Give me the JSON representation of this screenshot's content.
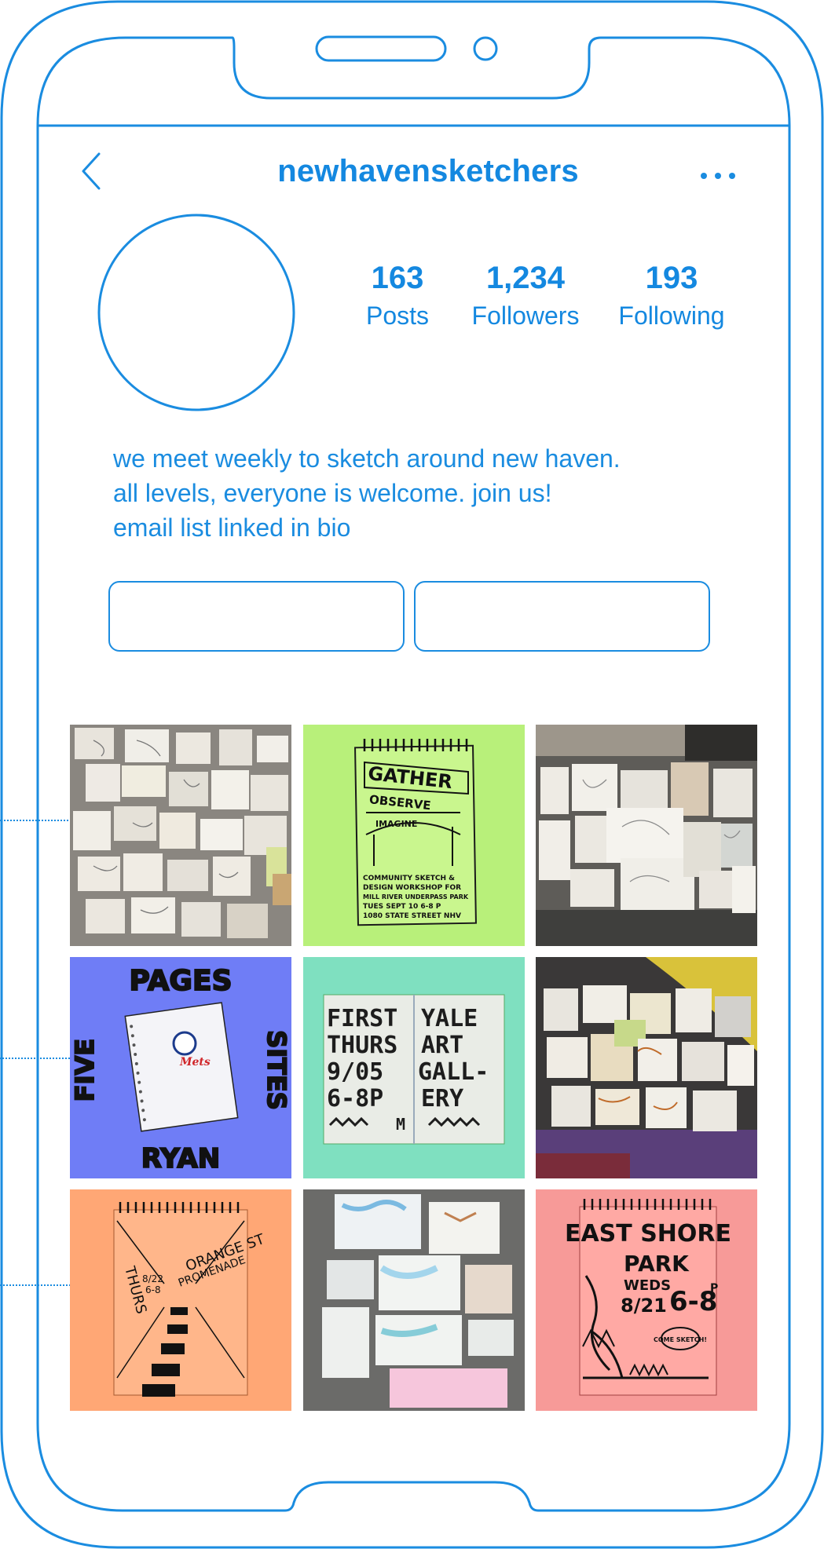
{
  "header": {
    "username": "newhavensketchers",
    "back_icon": "chevron-left-icon",
    "more_icon": "more-horizontal-icon"
  },
  "profile": {
    "avatar": "avatar-placeholder",
    "stats": [
      {
        "value": "163",
        "label": "Posts"
      },
      {
        "value": "1,234",
        "label": "Followers"
      },
      {
        "value": "193",
        "label": "Following"
      }
    ],
    "bio": [
      "we meet weekly to sketch around new haven.",
      "all levels, everyone is welcome. join us!",
      "email list linked in bio"
    ]
  },
  "colors": {
    "outline": "#1a8ce0",
    "tile_green": "#b8f07a",
    "tile_blue": "#6f7df6",
    "tile_teal": "#7fe0c0",
    "tile_orange": "#ffa775",
    "tile_pink": "#f79a98"
  },
  "posts": [
    {
      "kind": "photo-sketchbooks-on-pavement"
    },
    {
      "kind": "poster",
      "text": [
        "GATHER",
        "OBSERVE",
        "IMAGINE",
        "COMMUNITY SKETCH &",
        "DESIGN WORKSHOP FOR",
        "MILL RIVER UNDERPASS PARK",
        "TUES SEPT 10 6-8 P",
        "1080 STATE STREET NHV"
      ]
    },
    {
      "kind": "photo-sketchbooks-on-sidewalk"
    },
    {
      "kind": "poster",
      "text": [
        "PAGES",
        "FIVE",
        "SITES",
        "RYAN",
        "Mets"
      ]
    },
    {
      "kind": "poster",
      "text": [
        "FIRST",
        "THURS",
        "9/05",
        "6-8P",
        "M",
        "YALE",
        "ART",
        "GALL-",
        "ERY"
      ]
    },
    {
      "kind": "photo-sketchbooks-on-painted-ground"
    },
    {
      "kind": "poster",
      "text": [
        "THURS",
        "ORANGE ST",
        "PROMENADE",
        "8/22",
        "6-8"
      ]
    },
    {
      "kind": "photo-watercolor-sketchbooks"
    },
    {
      "kind": "poster",
      "text": [
        "EAST SHORE",
        "PARK",
        "WEDS",
        "8/21",
        "6-8",
        "P",
        "COME SKETCH!"
      ]
    }
  ]
}
